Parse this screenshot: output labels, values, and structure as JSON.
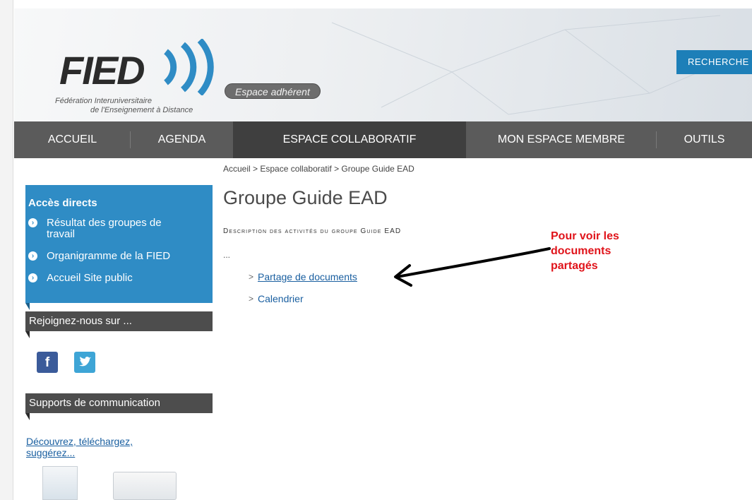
{
  "header": {
    "logo_text": "FIED",
    "logo_subtitle_line1": "Fédération Interuniversitaire",
    "logo_subtitle_line2": "de l'Enseignement à Distance",
    "espace_badge": "Espace adhérent",
    "search_button": "RECHERCHE",
    "brand_color": "#2f8cc5"
  },
  "nav": {
    "items": [
      {
        "label": "ACCUEIL"
      },
      {
        "label": "AGENDA"
      },
      {
        "label": "ESPACE COLLABORATIF",
        "active": true
      },
      {
        "label": "MON ESPACE MEMBRE"
      },
      {
        "label": "OUTILS"
      }
    ]
  },
  "breadcrumb": "Accueil > Espace collaboratif > Groupe Guide EAD",
  "sidebar": {
    "acces_title": "Accès directs",
    "acces_items": [
      {
        "label_line1": "Résultat des groupes de",
        "label_line2": "travail"
      },
      {
        "label_line1": "Organigramme de la FIED"
      },
      {
        "label_line1": "Accueil Site public"
      }
    ],
    "rejoignez": "Rejoignez-nous sur ...",
    "social_icons": [
      "facebook-icon",
      "twitter-icon"
    ],
    "supports": "Supports de communication",
    "decouvrez_line1": "Découvrez, téléchargez,",
    "decouvrez_line2": "suggérez..."
  },
  "main": {
    "title": "Groupe Guide EAD",
    "description": "Description des activités du groupe Guide EAD",
    "ellipsis": "...",
    "links": [
      {
        "label": "Partage de documents"
      },
      {
        "label": "Calendrier"
      }
    ]
  },
  "annotation": {
    "line1": "Pour voir les",
    "line2": "documents",
    "line3": "partagés",
    "color": "#e0131a"
  }
}
